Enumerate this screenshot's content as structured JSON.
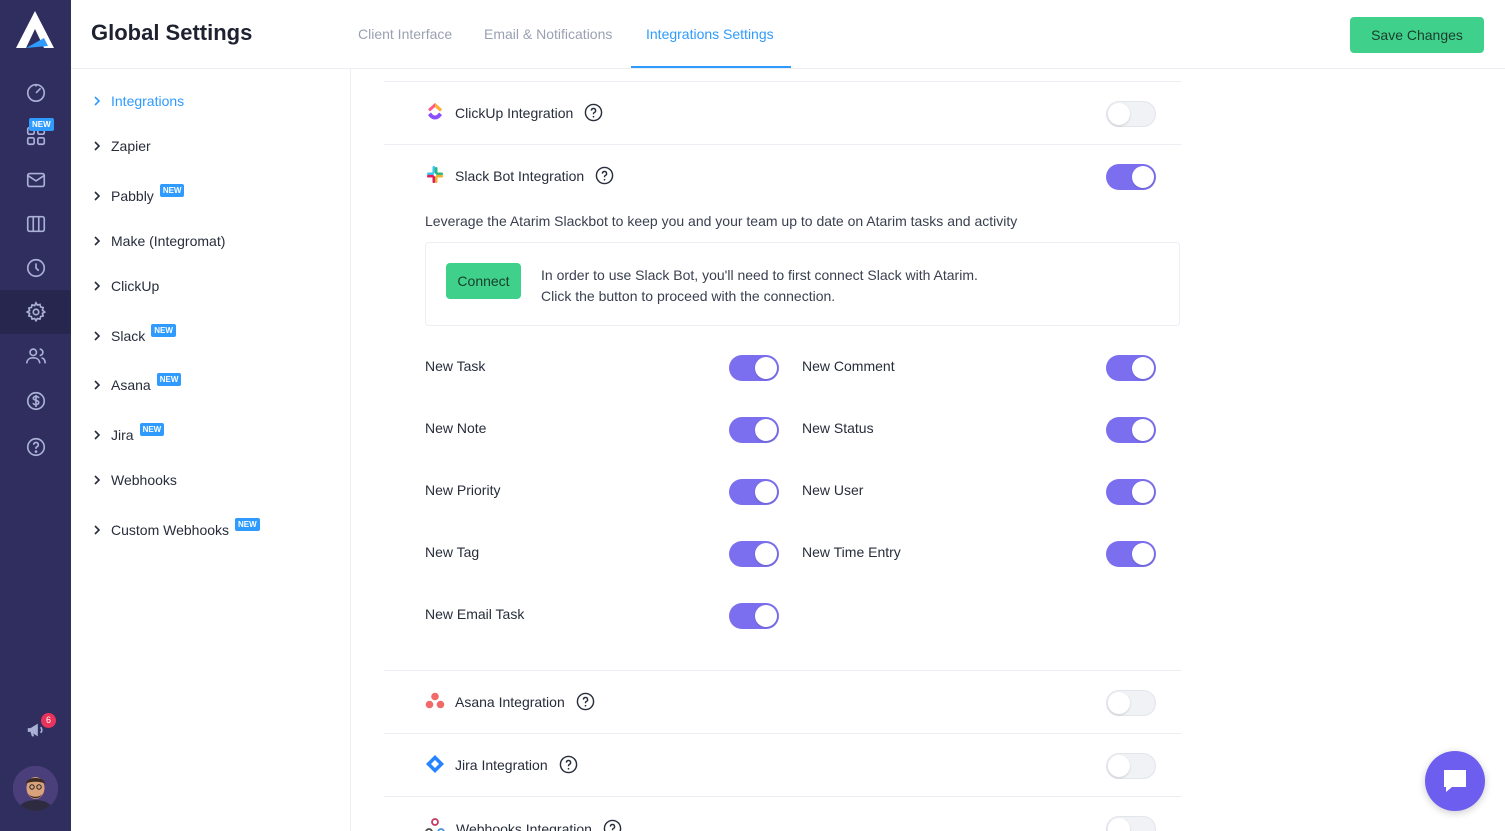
{
  "header": {
    "title": "Global Settings",
    "tabs": [
      {
        "label": "Client Interface",
        "active": false
      },
      {
        "label": "Email & Notifications",
        "active": false
      },
      {
        "label": "Integrations Settings",
        "active": true
      }
    ],
    "save_label": "Save Changes"
  },
  "rail": {
    "new_tag": "NEW",
    "notification_count": "6",
    "items": [
      "dashboard-icon",
      "apps-icon",
      "mail-icon",
      "board-icon",
      "clock-icon",
      "gear-icon",
      "users-icon",
      "dollar-icon",
      "help-icon"
    ],
    "active": "gear-icon"
  },
  "sidebar": {
    "new_tag": "NEW",
    "items": [
      {
        "label": "Integrations",
        "new": false,
        "active": true
      },
      {
        "label": "Zapier",
        "new": false,
        "active": false
      },
      {
        "label": "Pabbly",
        "new": true,
        "active": false
      },
      {
        "label": "Make (Integromat)",
        "new": false,
        "active": false
      },
      {
        "label": "ClickUp",
        "new": false,
        "active": false
      },
      {
        "label": "Slack",
        "new": true,
        "active": false
      },
      {
        "label": "Asana",
        "new": true,
        "active": false
      },
      {
        "label": "Jira",
        "new": true,
        "active": false
      },
      {
        "label": "Webhooks",
        "new": false,
        "active": false
      },
      {
        "label": "Custom Webhooks",
        "new": true,
        "active": false
      }
    ]
  },
  "integrations": {
    "clickup": {
      "title": "ClickUp Integration",
      "enabled": false
    },
    "slack": {
      "title": "Slack Bot Integration",
      "enabled": true,
      "description": "Leverage the Atarim Slackbot to keep you and your team up to date on Atarim tasks and activity",
      "connect_label": "Connect",
      "connect_line1": "In order to use Slack Bot, you'll need to first connect Slack with Atarim.",
      "connect_line2": "Click the button to proceed with the connection.",
      "events": [
        {
          "label": "New Task",
          "enabled": true
        },
        {
          "label": "New Comment",
          "enabled": true
        },
        {
          "label": "New Note",
          "enabled": true
        },
        {
          "label": "New Status",
          "enabled": true
        },
        {
          "label": "New Priority",
          "enabled": true
        },
        {
          "label": "New User",
          "enabled": true
        },
        {
          "label": "New Tag",
          "enabled": true
        },
        {
          "label": "New Time Entry",
          "enabled": true
        },
        {
          "label": "New Email Task",
          "enabled": true
        }
      ]
    },
    "asana": {
      "title": "Asana Integration",
      "enabled": false
    },
    "jira": {
      "title": "Jira Integration",
      "enabled": false
    },
    "webhooks": {
      "title": "Webhooks Integration",
      "enabled": false
    }
  },
  "colors": {
    "rail_bg": "#2f2e5e",
    "accent_blue": "#2f9bff",
    "green": "#3fd18b",
    "toggle_on": "#7b6ff0"
  }
}
